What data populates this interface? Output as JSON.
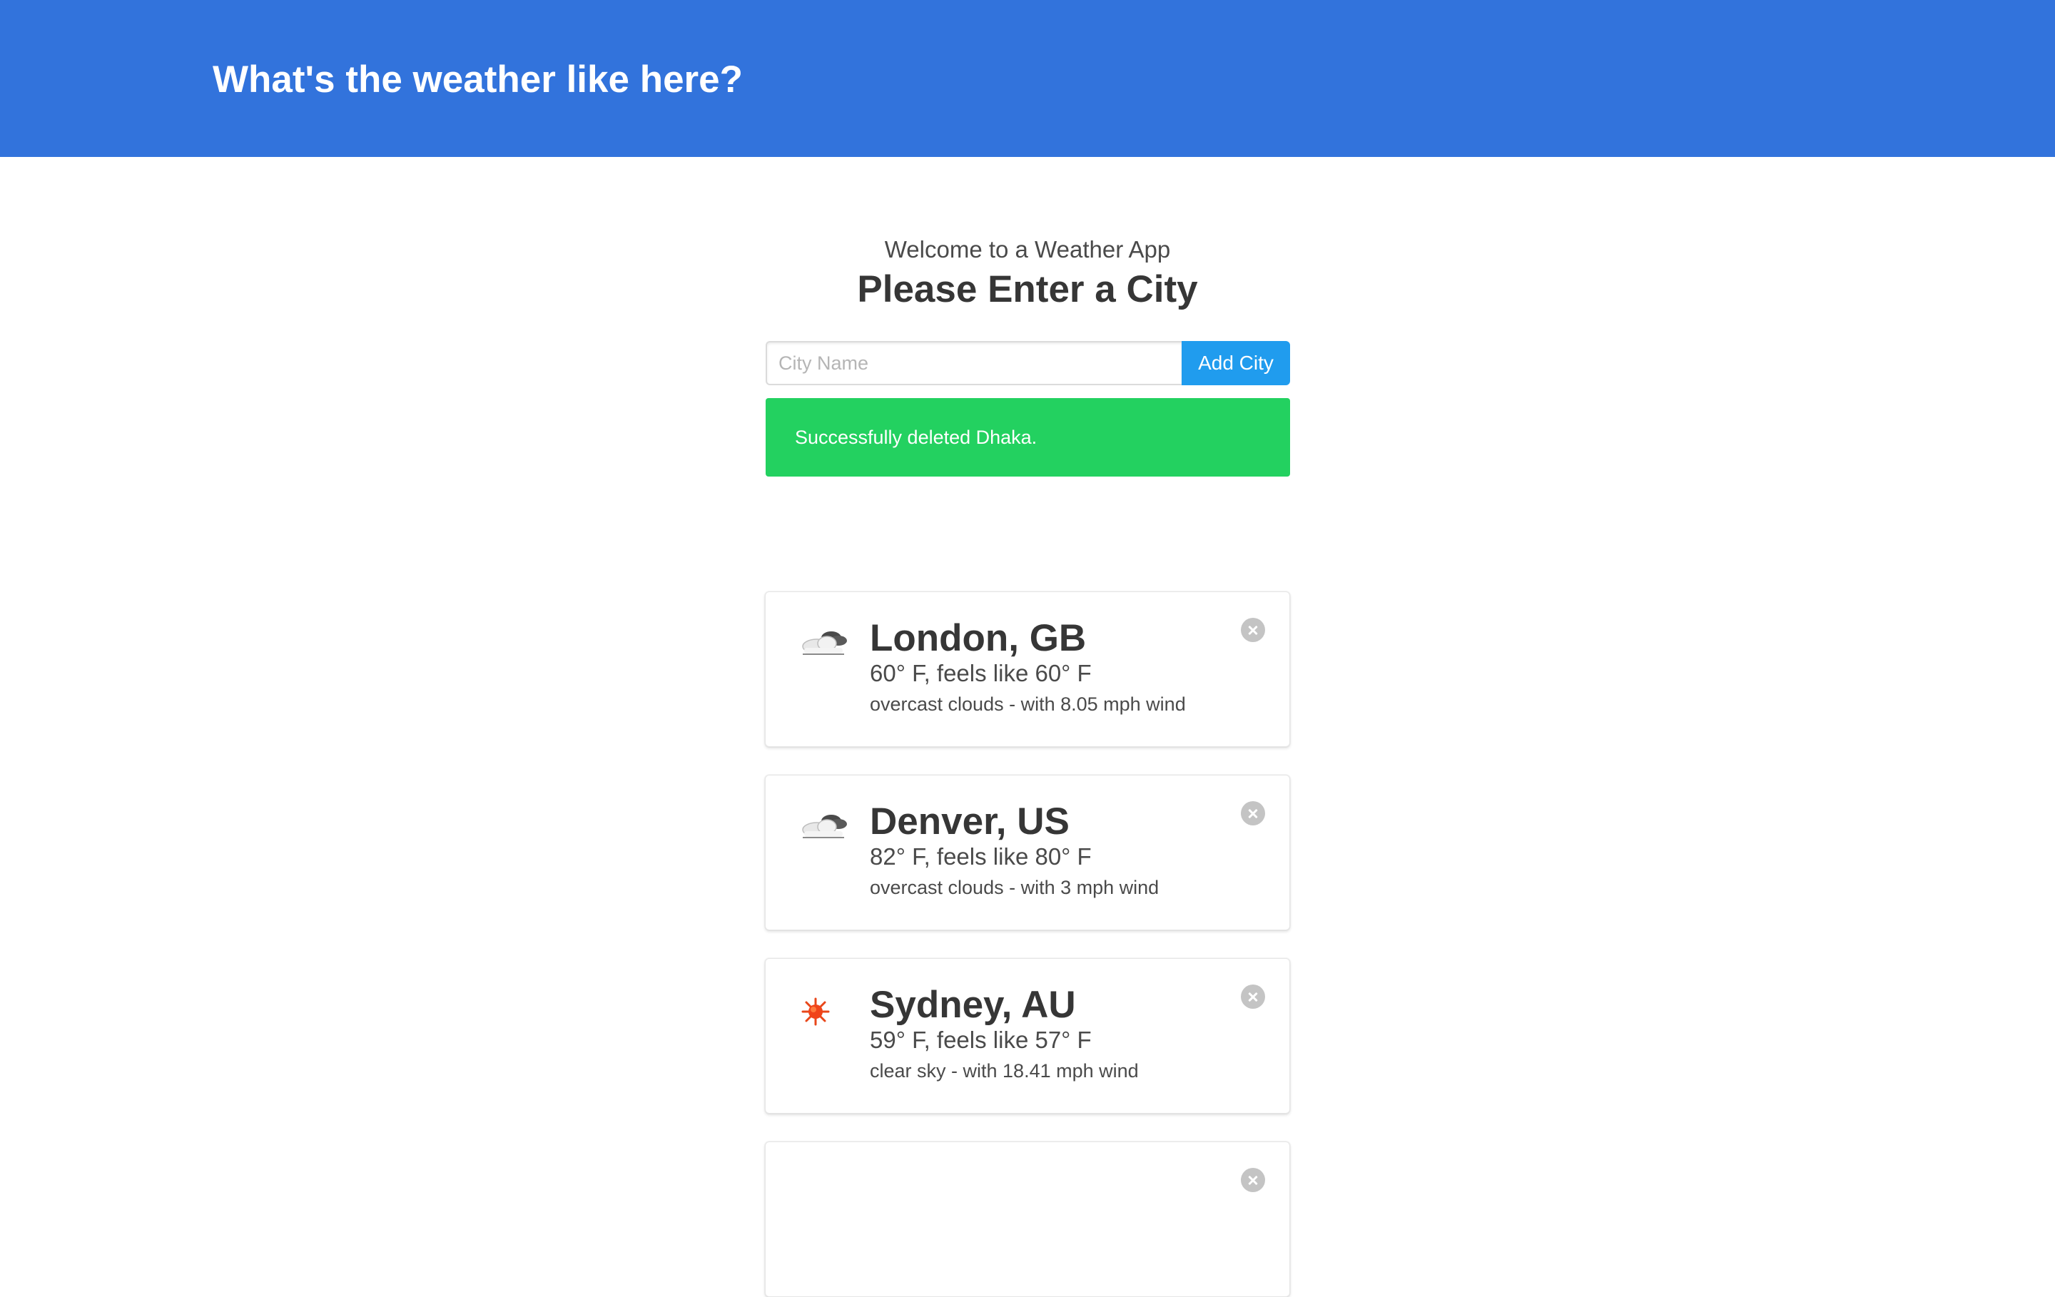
{
  "header": {
    "title": "What's the weather like here?"
  },
  "intro": {
    "subtitle": "Welcome to a Weather App",
    "title": "Please Enter a City"
  },
  "form": {
    "placeholder": "City Name",
    "value": "",
    "add_label": "Add City"
  },
  "notification": {
    "message": "Successfully deleted Dhaka."
  },
  "cities": [
    {
      "name": "London, GB",
      "temp": "60° F, feels like 60° F",
      "desc": "overcast clouds - with 8.05 mph wind",
      "icon": "overcast-clouds-icon"
    },
    {
      "name": "Denver, US",
      "temp": "82° F, feels like 80° F",
      "desc": "overcast clouds - with 3 mph wind",
      "icon": "overcast-clouds-icon"
    },
    {
      "name": "Sydney, AU",
      "temp": "59° F, feels like 57° F",
      "desc": "clear sky - with 18.41 mph wind",
      "icon": "sun-icon"
    }
  ],
  "colors": {
    "hero": "#3273dc",
    "button": "#209cee",
    "success": "#23d160"
  }
}
